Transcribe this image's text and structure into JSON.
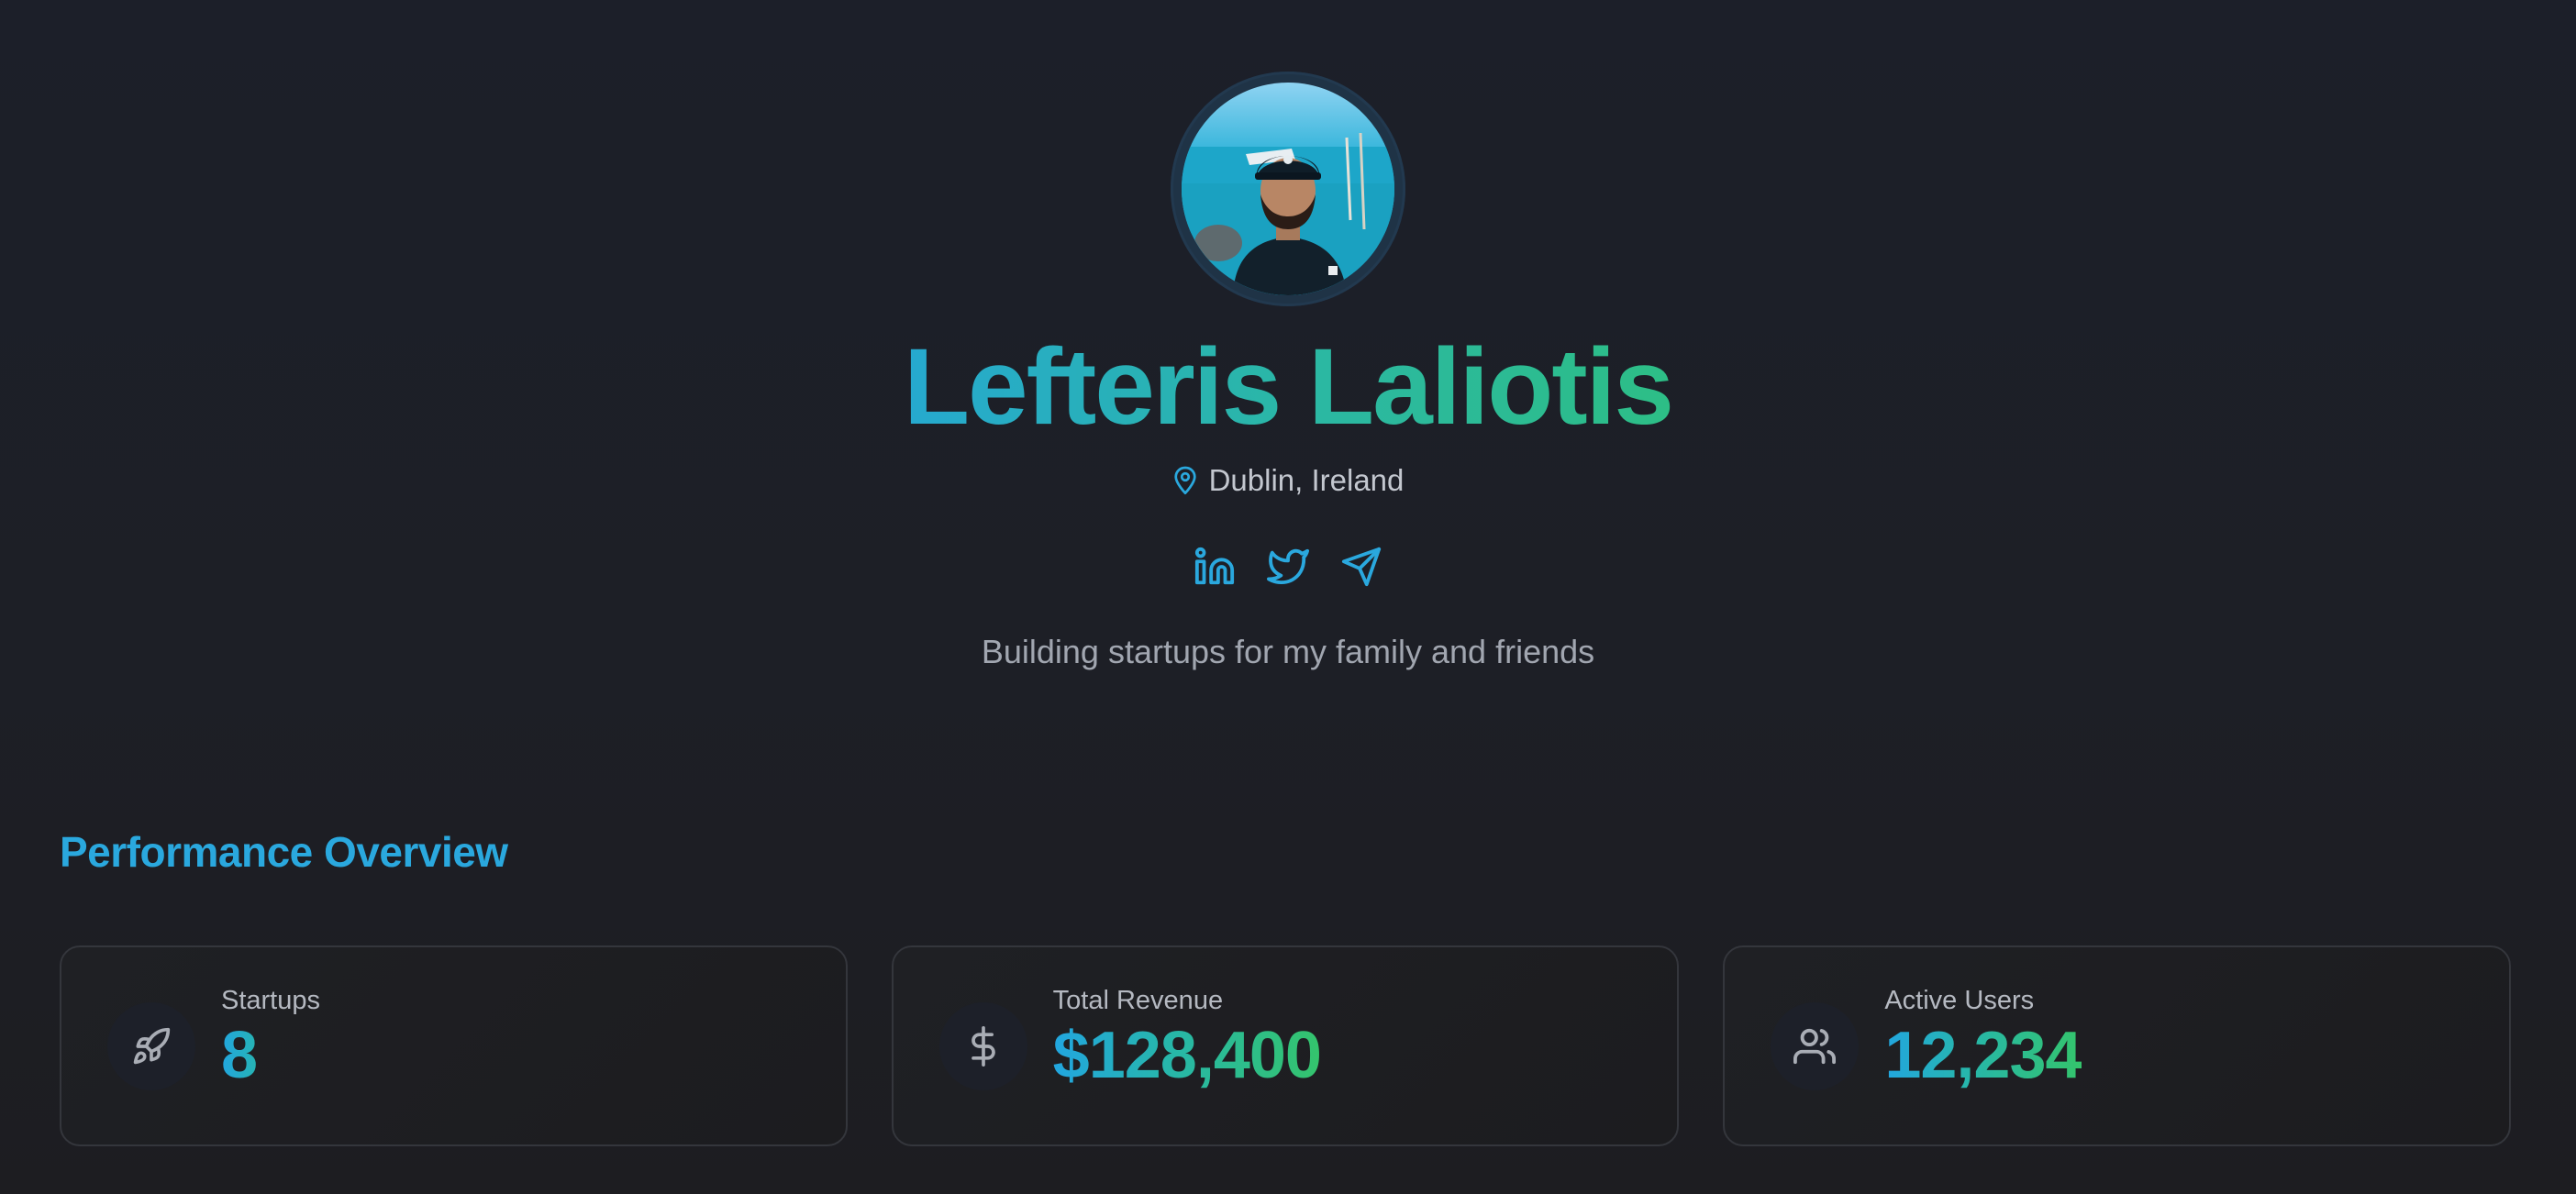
{
  "profile": {
    "name": "Lefteris Laliotis",
    "location": "Dublin, Ireland",
    "tagline": "Building startups for my family and friends",
    "socials": [
      "linkedin-icon",
      "twitter-icon",
      "send-icon"
    ]
  },
  "performance": {
    "title": "Performance Overview",
    "cards": [
      {
        "label": "Startups",
        "value": "8",
        "icon": "rocket-icon"
      },
      {
        "label": "Total Revenue",
        "value": "$128,400",
        "icon": "dollar-icon"
      },
      {
        "label": "Active Users",
        "value": "12,234",
        "icon": "users-icon"
      }
    ]
  },
  "colors": {
    "background": "#1c1f29",
    "accent_blue": "#2aa8de",
    "accent_teal": "#2bb8a2",
    "accent_green": "#34c46c",
    "muted_text": "#a1a6b0",
    "card_border": "#34363c"
  }
}
